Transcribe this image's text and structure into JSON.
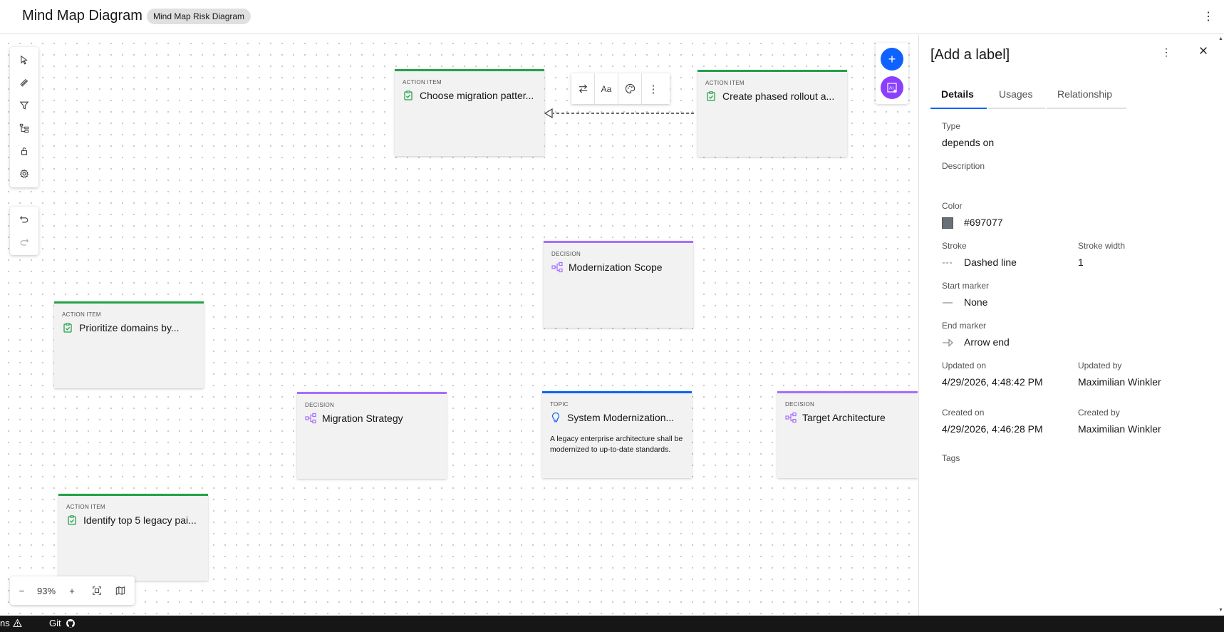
{
  "header": {
    "title": "Mind Map Diagram",
    "tag": "Mind Map Risk Diagram",
    "menu_icon": "overflow-menu-vertical-icon"
  },
  "canvas": {
    "zoom": "93%",
    "zoom_out": "−",
    "zoom_in": "+",
    "nodes": [
      {
        "type": "ACTION ITEM",
        "title": "Choose migration patter...",
        "icon": "task-icon"
      },
      {
        "type": "ACTION ITEM",
        "title": "Create phased rollout a...",
        "icon": "task-icon"
      },
      {
        "type": "DECISION",
        "title": "Modernization Scope",
        "icon": "decision-tree-icon"
      },
      {
        "type": "ACTION ITEM",
        "title": "Prioritize domains by...",
        "icon": "task-icon"
      },
      {
        "type": "DECISION",
        "title": "Migration Strategy",
        "icon": "decision-tree-icon"
      },
      {
        "type": "TOPIC",
        "title": "System Modernization...",
        "icon": "lightbulb-icon",
        "description": "A legacy enterprise architecture shall be modernized to up-to-date standards."
      },
      {
        "type": "DECISION",
        "title": "Target Architecture",
        "icon": "decision-tree-icon"
      },
      {
        "type": "ACTION ITEM",
        "title": "Identify top 5 legacy pai...",
        "icon": "task-icon"
      }
    ],
    "edge_toolbar": {
      "text_label": "Aa"
    },
    "colors": {
      "action": "#24a148",
      "decision": "#a56eff",
      "topic": "#0f62fe",
      "edge": "#393939"
    }
  },
  "panel": {
    "title": "[Add a label]",
    "tabs": [
      "Details",
      "Usages",
      "Relationship"
    ],
    "active_tab": "Details",
    "fields": {
      "type_label": "Type",
      "type_value": "depends on",
      "description_label": "Description",
      "color_label": "Color",
      "color_value": "#697077",
      "stroke_label": "Stroke",
      "stroke_value": "Dashed line",
      "stroke_width_label": "Stroke width",
      "stroke_width_value": "1",
      "start_marker_label": "Start marker",
      "start_marker_value": "None",
      "end_marker_label": "End marker",
      "end_marker_value": "Arrow end",
      "updated_on_label": "Updated on",
      "updated_on_value": "4/29/2026, 4:48:42 PM",
      "updated_by_label": "Updated by",
      "updated_by_value": "Maximilian Winkler",
      "created_on_label": "Created on",
      "created_on_value": "4/29/2026, 4:46:28 PM",
      "created_by_label": "Created by",
      "created_by_value": "Maximilian Winkler",
      "tags_label": "Tags"
    }
  },
  "statusbar": {
    "left_text": "ns",
    "git_label": "Git"
  }
}
